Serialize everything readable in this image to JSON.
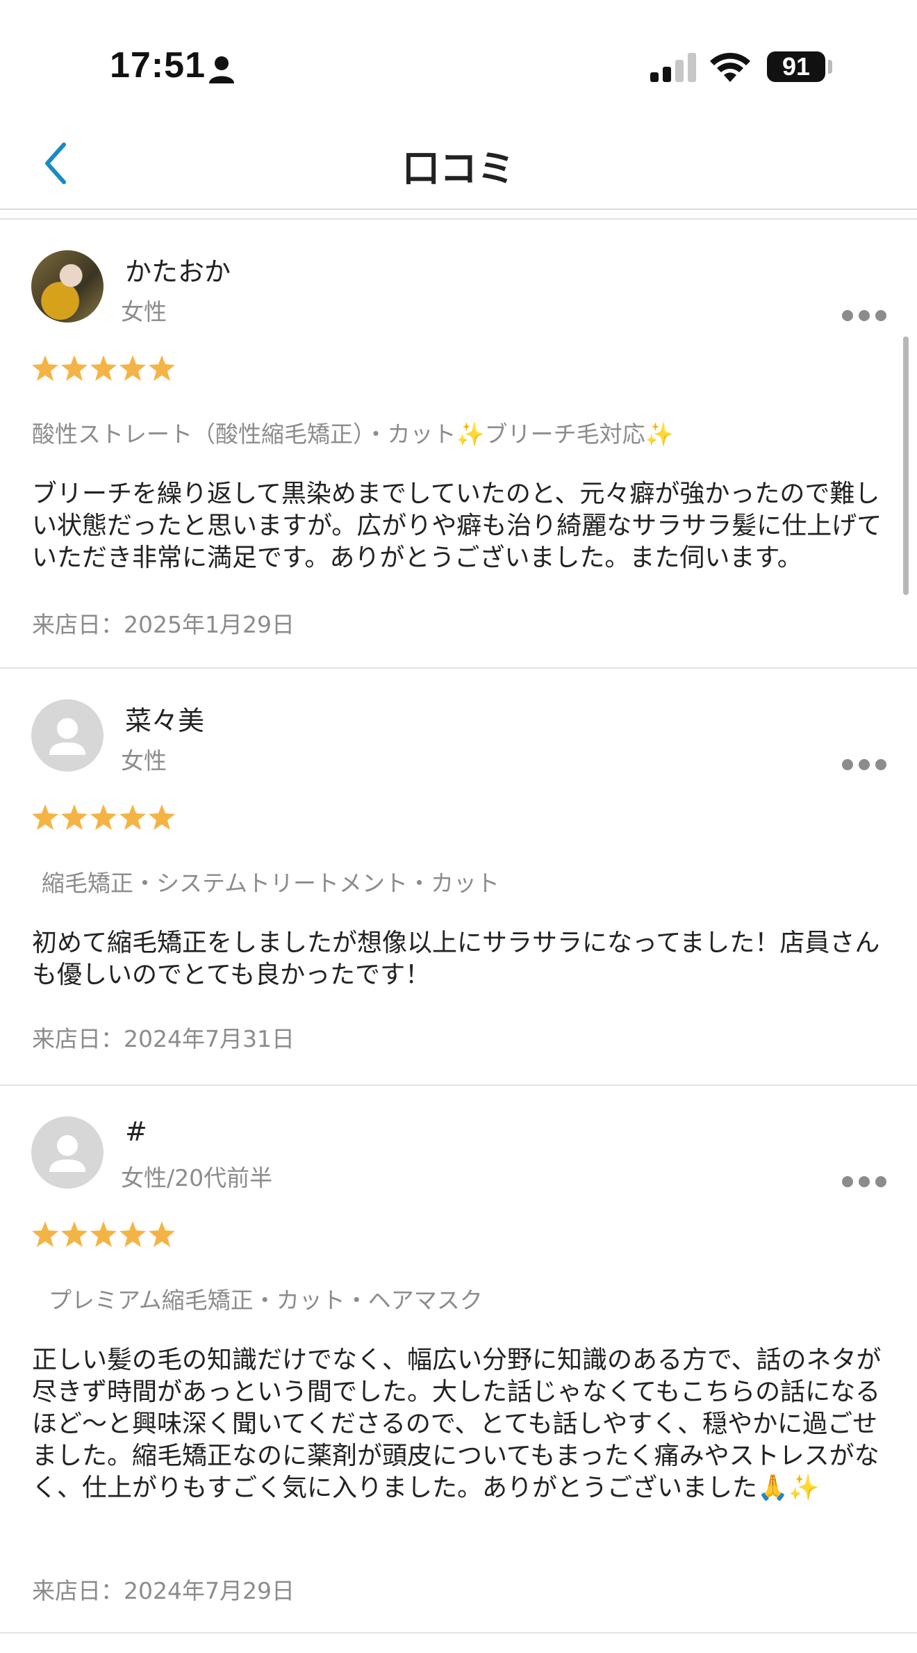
{
  "status_bar": {
    "time": "17:51",
    "battery": "91",
    "icons": [
      "person-icon",
      "cellular-signal-icon",
      "wifi-icon",
      "battery-icon"
    ]
  },
  "nav": {
    "title": "口コミ",
    "back_icon": "chevron-left-icon",
    "accent_color": "#1a8ac4"
  },
  "star_color": "#f4b445",
  "reviews": [
    {
      "name": "かたおか",
      "meta": "女性",
      "avatar": "photo",
      "rating": 5,
      "menu": "酸性ストレート（酸性縮毛矯正）・カット✨ブリーチ毛対応✨",
      "body": "ブリーチを繰り返して黒染めまでしていたのと、元々癖が強かったので難しい状態だったと思いますが。広がりや癖も治り綺麗なサラサラ髪に仕上げていただき非常に満足です。ありがとうございました。また伺います。",
      "visit_date": "来店日：2025年1月29日"
    },
    {
      "name": "菜々美",
      "meta": "女性",
      "avatar": "default",
      "rating": 5,
      "menu": "縮毛矯正・システムトリートメント・カット",
      "body": "初めて縮毛矯正をしましたが想像以上にサラサラになってました！店員さんも優しいのでとても良かったです！",
      "visit_date": "来店日：2024年7月31日"
    },
    {
      "name": "#",
      "meta": "女性/20代前半",
      "avatar": "default",
      "rating": 5,
      "menu": "プレミアム縮毛矯正・カット・ヘアマスク",
      "body": "正しい髪の毛の知識だけでなく、幅広い分野に知識のある方で、話のネタが尽きず時間があっという間でした。大した話じゃなくてもこちらの話になるほど〜と興味深く聞いてくださるので、とても話しやすく、穏やかに過ごせました。縮毛矯正なのに薬剤が頭皮についてもまったく痛みやストレスがなく、仕上がりもすごく気に入りました。ありがとうございました🙏✨",
      "visit_date": "来店日：2024年7月29日"
    }
  ]
}
